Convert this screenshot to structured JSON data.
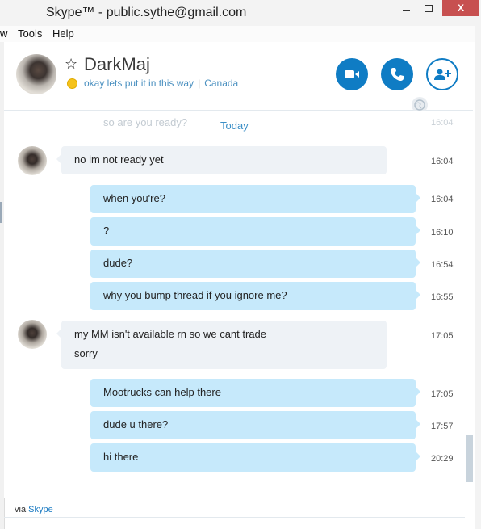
{
  "window": {
    "title": "Skype™ - public.sythe@gmail.com",
    "minimize_label": "",
    "close_label": "X"
  },
  "menu": {
    "items": [
      "w",
      "Tools",
      "Help"
    ]
  },
  "contact": {
    "name": "DarkMaj",
    "mood": "okay lets put it in this way",
    "location": "Canada",
    "status_color": "#f5c21b"
  },
  "header_buttons": [
    "video-call",
    "audio-call",
    "add-contact"
  ],
  "chat": {
    "ghost_message": "so are you ready?",
    "ghost_time": "16:04",
    "date_divider": "Today",
    "messages": [
      {
        "direction": "in",
        "lines": [
          "no im not ready yet"
        ],
        "time": "16:04"
      },
      {
        "direction": "out",
        "lines": [
          "when you're?"
        ],
        "time": "16:04"
      },
      {
        "direction": "out",
        "lines": [
          "?"
        ],
        "time": "16:10"
      },
      {
        "direction": "out",
        "lines": [
          "dude?"
        ],
        "time": "16:54"
      },
      {
        "direction": "out",
        "lines": [
          "why you bump thread if you ignore me?"
        ],
        "time": "16:55"
      },
      {
        "direction": "in",
        "lines": [
          "my MM isn't available rn so we cant trade",
          "sorry"
        ],
        "time": "17:05"
      },
      {
        "direction": "out",
        "lines": [
          "Mootrucks can help there"
        ],
        "time": "17:05"
      },
      {
        "direction": "out",
        "lines": [
          "dude u there?"
        ],
        "time": "17:57"
      },
      {
        "direction": "out",
        "lines": [
          "hi there"
        ],
        "time": "20:29"
      }
    ]
  },
  "footer": {
    "via_prefix": "via",
    "via_link": "Skype"
  },
  "colors": {
    "accent": "#0f7cc4",
    "outgoing_bubble": "#c6e9fb",
    "incoming_bubble": "#eef2f6"
  }
}
